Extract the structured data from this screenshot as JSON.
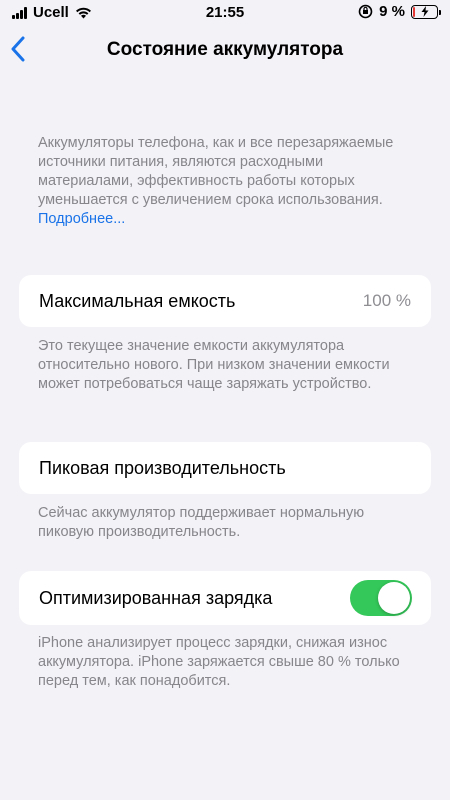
{
  "status_bar": {
    "carrier": "Ucell",
    "time": "21:55",
    "battery_percent": "9 %",
    "battery_level": 0.09
  },
  "nav": {
    "title": "Состояние аккумулятора"
  },
  "intro": {
    "text": "Аккумуляторы телефона, как и все перезаряжаемые источники питания, являются расходными материалами, эффективность работы которых уменьшается с увеличением срока использования. ",
    "link": "Подробнее..."
  },
  "max_capacity": {
    "label": "Максимальная емкость",
    "value": "100 %",
    "footnote": "Это текущее значение емкости аккумулятора относительно нового. При низком значении емкости может потребоваться чаще заряжать устройство."
  },
  "peak_performance": {
    "label": "Пиковая производительность",
    "footnote": "Сейчас аккумулятор поддерживает нормальную пиковую производительность."
  },
  "optimized_charging": {
    "label": "Оптимизированная зарядка",
    "enabled": true,
    "footnote": "iPhone анализирует процесс зарядки, снижая износ аккумулятора. iPhone заряжается свыше 80 % только перед тем, как понадобится."
  },
  "colors": {
    "accent": "#1a73e8",
    "toggle_on": "#34c759",
    "battery_low": "#e53935"
  }
}
